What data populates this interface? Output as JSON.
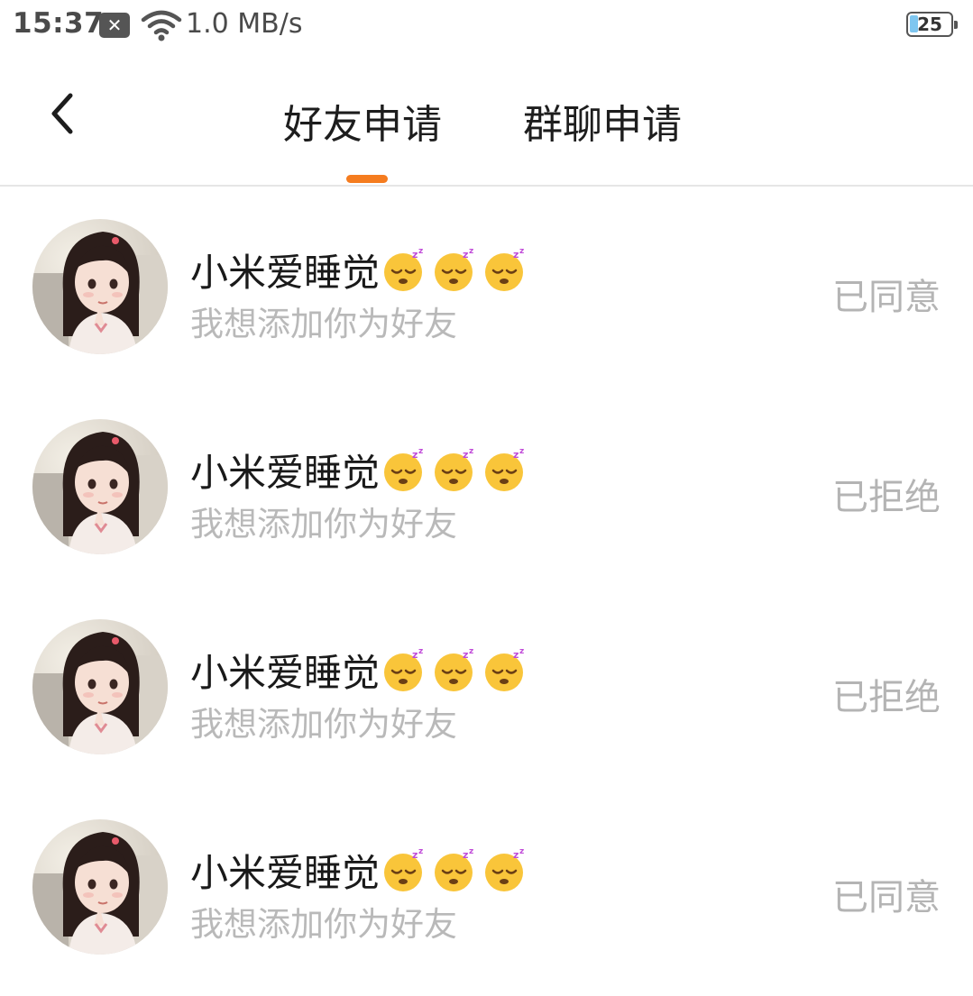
{
  "status_bar": {
    "time": "15:37",
    "notification_icon": "close-box-icon",
    "wifi_icon": "wifi-icon",
    "speed": "1.0 MB/s",
    "battery": "25"
  },
  "header": {
    "back_icon": "chevron-left-icon",
    "tabs": [
      {
        "label": "好友申请",
        "active": true
      },
      {
        "label": "群聊申请",
        "active": false
      }
    ],
    "accent_color": "#f57c1f"
  },
  "requests": [
    {
      "name": "小米爱睡觉",
      "emoji_count": 3,
      "message": "我想添加你为好友",
      "status": "已同意"
    },
    {
      "name": "小米爱睡觉",
      "emoji_count": 3,
      "message": "我想添加你为好友",
      "status": "已拒绝"
    },
    {
      "name": "小米爱睡觉",
      "emoji_count": 3,
      "message": "我想添加你为好友",
      "status": "已拒绝"
    },
    {
      "name": "小米爱睡觉",
      "emoji_count": 3,
      "message": "我想添加你为好友",
      "status": "已同意"
    }
  ]
}
